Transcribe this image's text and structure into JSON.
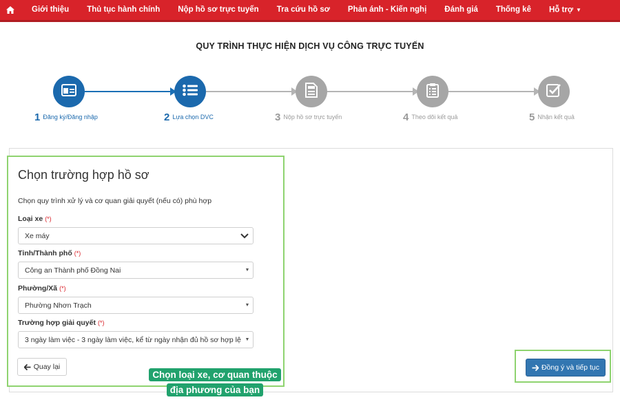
{
  "nav": {
    "home_icon": "home-icon",
    "items": [
      "Giới thiệu",
      "Thủ tục hành chính",
      "Nộp hồ sơ trực tuyến",
      "Tra cứu hồ sơ",
      "Phản ánh - Kiến nghị",
      "Đánh giá",
      "Thống kê",
      "Hỗ trợ"
    ],
    "color": "#d8232a"
  },
  "page_title": "QUY TRÌNH THỰC HIỆN DỊCH VỤ CÔNG TRỰC TUYẾN",
  "steps": [
    {
      "num": "1",
      "label": "Đăng ký/Đăng nhập",
      "icon": "id-card-icon",
      "active": true
    },
    {
      "num": "2",
      "label": "Lựa chọn DVC",
      "icon": "list-icon",
      "active": true
    },
    {
      "num": "3",
      "label": "Nộp hồ sơ trực tuyến",
      "icon": "document-icon",
      "active": false
    },
    {
      "num": "4",
      "label": "Theo dõi kết quả",
      "icon": "clipboard-icon",
      "active": false
    },
    {
      "num": "5",
      "label": "Nhận kết quả",
      "icon": "check-square-icon",
      "active": false
    }
  ],
  "form": {
    "heading": "Chọn trường hợp hồ sơ",
    "description": "Chọn quy trình xử lý và cơ quan giải quyết (nếu có) phù hợp",
    "required_mark": "(*)",
    "vehicle": {
      "label": "Loại xe",
      "value": "Xe máy"
    },
    "province": {
      "label": "Tỉnh/Thành phố",
      "value": "Công an Thành phố Đồng Nai"
    },
    "ward": {
      "label": "Phường/Xã",
      "value": "Phường Nhơn Trạch"
    },
    "case": {
      "label": "Trường hợp giải quyết",
      "value": "3 ngày làm việc - 3 ngày làm việc, kể từ ngày nhận đủ hồ sơ hợp lệ"
    },
    "back_label": "Quay lại"
  },
  "agree_label": "Đồng ý và tiếp tục",
  "note": [
    "Chọn loại xe, cơ quan thuộc",
    "địa phương của bạn"
  ],
  "colors": {
    "primary": "#1b69ad",
    "inactive": "#a6a6a6",
    "highlight_border": "#8ed36f",
    "note_bg": "#21a26d",
    "button": "#3276b1"
  }
}
